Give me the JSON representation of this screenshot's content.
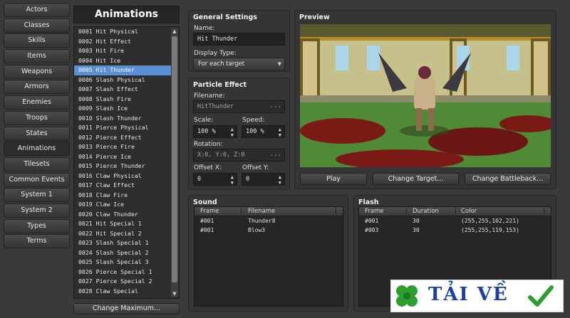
{
  "sidebar": {
    "items": [
      "Actors",
      "Classes",
      "Skills",
      "Items",
      "Weapons",
      "Armors",
      "Enemies",
      "Troops",
      "States",
      "Animations",
      "Tilesets",
      "Common Events",
      "System 1",
      "System 2",
      "Types",
      "Terms"
    ],
    "active_index": 9
  },
  "animation_list": {
    "title": "Animations",
    "items": [
      "0001 Hit Physical",
      "0002 Hit Effect",
      "0003 Hit Fire",
      "0004 Hit Ice",
      "0005 Hit Thunder",
      "0006 Slash Physical",
      "0007 Slash Effect",
      "0008 Slash Fire",
      "0009 Slash Ice",
      "0010 Slash Thunder",
      "0011 Pierce Physical",
      "0012 Pierce Effect",
      "0013 Pierce Fire",
      "0014 Pierce Ice",
      "0015 Pierce Thunder",
      "0016 Claw Physical",
      "0017 Claw Effect",
      "0018 Claw Fire",
      "0019 Claw Ice",
      "0020 Claw Thunder",
      "0021 Hit Special 1",
      "0022 Hit Special 2",
      "0023 Slash Special 1",
      "0024 Slash Special 2",
      "0025 Slash Special 3",
      "0026 Pierce Special 1",
      "0027 Pierce Special 2",
      "0028 Claw Special"
    ],
    "selected_index": 4,
    "change_max_label": "Change Maximum..."
  },
  "general": {
    "title": "General Settings",
    "name_label": "Name:",
    "name_value": "Hit Thunder",
    "display_type_label": "Display Type:",
    "display_type_value": "For each target"
  },
  "particle": {
    "title": "Particle Effect",
    "filename_label": "Filename:",
    "filename_value": "HitThunder",
    "scale_label": "Scale:",
    "scale_value": "100 %",
    "speed_label": "Speed:",
    "speed_value": "100 %",
    "rotation_label": "Rotation:",
    "rotation_value": "X:0, Y:0, Z:0",
    "offset_x_label": "Offset X:",
    "offset_x_value": "0",
    "offset_y_label": "Offset Y:",
    "offset_y_value": "0",
    "dots": "..."
  },
  "preview": {
    "title": "Preview",
    "play_label": "Play",
    "change_target_label": "Change Target...",
    "change_battleback_label": "Change Battleback..."
  },
  "sound": {
    "title": "Sound",
    "columns": [
      "Frame",
      "Filename"
    ],
    "rows": [
      [
        "#001",
        "Thunder8"
      ],
      [
        "#001",
        "Blow3"
      ]
    ]
  },
  "flash": {
    "title": "Flash",
    "columns": [
      "Frame",
      "Duration",
      "Color"
    ],
    "rows": [
      [
        "#001",
        "30",
        "(255,255,102,221)"
      ],
      [
        "#003",
        "30",
        "(255,255,119,153)"
      ]
    ]
  },
  "watermark": {
    "text": "TẢI VỀ"
  },
  "colors": {
    "selection": "#5b8fd6",
    "panel_bg": "#353535",
    "app_bg": "#3a3a3a"
  }
}
